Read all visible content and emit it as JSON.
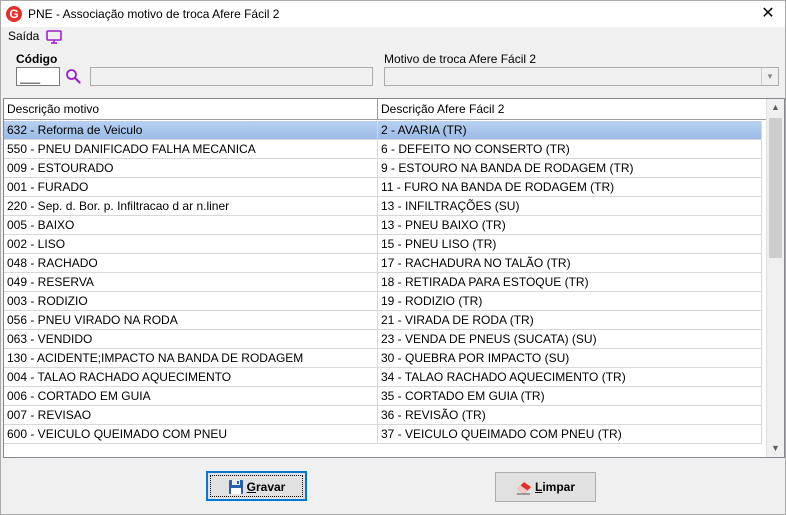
{
  "window": {
    "title": "PNE - Associação motivo de troca Afere Fácil 2",
    "logo_letter": "G",
    "close_glyph": "✕"
  },
  "menu": {
    "saida_label": "Saída"
  },
  "form": {
    "codigo_label": "Código",
    "codigo_value": "___",
    "motivo_label": "Motivo de troca Afere Fácil 2",
    "motivo_value": ""
  },
  "grid": {
    "columns": [
      "Descrição motivo",
      "Descrição Afere Fácil 2"
    ],
    "rows": [
      [
        "632 - Reforma de Veiculo",
        "2 - AVARIA (TR)"
      ],
      [
        "550 - PNEU DANIFICADO FALHA MECANICA",
        "6 - DEFEITO NO CONSERTO (TR)"
      ],
      [
        "009 - ESTOURADO",
        "9 - ESTOURO NA BANDA DE RODAGEM (TR)"
      ],
      [
        "001 - FURADO",
        "11 - FURO NA BANDA DE RODAGEM (TR)"
      ],
      [
        "220 - Sep. d. Bor. p. Infiltracao d ar n.liner",
        "13 - INFILTRAÇÕES (SU)"
      ],
      [
        "005 - BAIXO",
        "13 - PNEU BAIXO (TR)"
      ],
      [
        "002 - LISO",
        "15 - PNEU LISO (TR)"
      ],
      [
        "048 - RACHADO",
        "17 - RACHADURA NO TALÃO (TR)"
      ],
      [
        "049 - RESERVA",
        "18 - RETIRADA PARA ESTOQUE (TR)"
      ],
      [
        "003 - RODIZIO",
        "19 - RODIZIO (TR)"
      ],
      [
        "056 - PNEU VIRADO NA RODA",
        "21 - VIRADA DE RODA (TR)"
      ],
      [
        "063 - VENDIDO",
        "23 - VENDA DE PNEUS (SUCATA) (SU)"
      ],
      [
        "130 - ACIDENTE;IMPACTO NA BANDA DE RODAGEM",
        "30 - QUEBRA POR IMPACTO (SU)"
      ],
      [
        "004 - TALAO RACHADO AQUECIMENTO",
        "34 - TALAO RACHADO AQUECIMENTO (TR)"
      ],
      [
        "006 - CORTADO EM GUIA",
        "35 - CORTADO EM GUIA (TR)"
      ],
      [
        "007 - REVISAO",
        "36 - REVISÃO (TR)"
      ],
      [
        "600 - VEICULO QUEIMADO COM PNEU",
        "37 - VEICULO QUEIMADO COM PNEU (TR)"
      ]
    ],
    "selected_index": 0
  },
  "buttons": {
    "gravar_first": "G",
    "gravar_rest": "ravar",
    "limpar_first": "L",
    "limpar_rest": "impar"
  },
  "icons": {
    "monitor": "monitor-icon",
    "search": "search-icon",
    "save": "floppy-disk-icon",
    "clear": "eraser-icon"
  },
  "colors": {
    "accent_purple": "#a020c8",
    "logo_red": "#e5302b",
    "selection": "#9bbbe6",
    "focus_border": "#0078d7"
  }
}
